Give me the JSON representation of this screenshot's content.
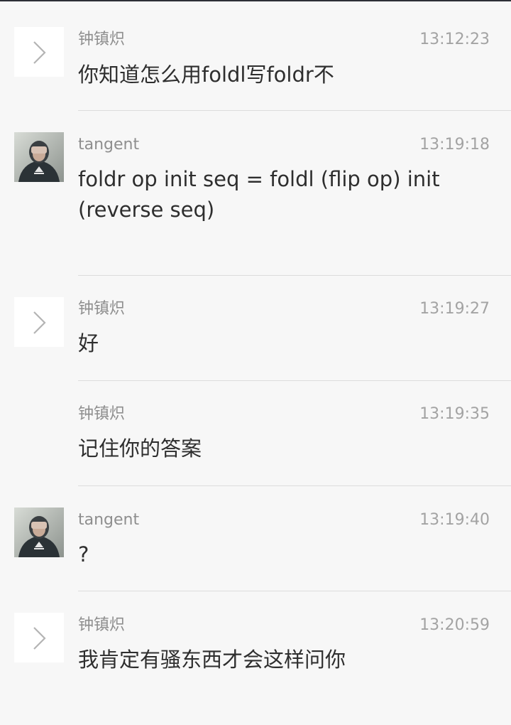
{
  "messages": [
    {
      "sender": "钟镇炽",
      "time": "13:12:23",
      "text": "你知道怎么用foldl写foldr不",
      "avatar": "chevron-right-icon"
    },
    {
      "sender": "tangent",
      "time": "13:19:18",
      "text": "foldr op init seq = foldl (flip op) init (reverse seq)",
      "avatar": "user-photo"
    },
    {
      "sender": "钟镇炽",
      "time": "13:19:27",
      "text": "好",
      "avatar": "chevron-right-icon"
    },
    {
      "sender": "钟镇炽",
      "time": "13:19:35",
      "text": "记住你的答案",
      "avatar": ""
    },
    {
      "sender": "tangent",
      "time": "13:19:40",
      "text": "?",
      "avatar": "user-photo"
    },
    {
      "sender": "钟镇炽",
      "time": "13:20:59",
      "text": "我肯定有骚东西才会这样问你",
      "avatar": "chevron-right-icon"
    }
  ]
}
